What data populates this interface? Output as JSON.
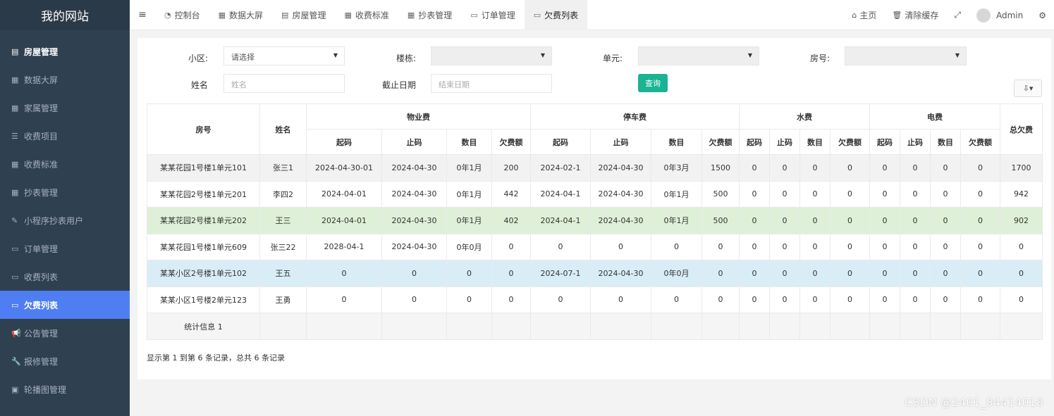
{
  "sidebar": {
    "brand": "我的网站",
    "items": [
      {
        "icon": "document-icon",
        "glyph": "▤",
        "label": "房屋管理"
      },
      {
        "icon": "table-icon",
        "glyph": "▦",
        "label": "数据大屏"
      },
      {
        "icon": "table-icon",
        "glyph": "▦",
        "label": "家属管理"
      },
      {
        "icon": "list-icon",
        "glyph": "☰",
        "label": "收费项目"
      },
      {
        "icon": "table-icon",
        "glyph": "▦",
        "label": "收费标准"
      },
      {
        "icon": "table-icon",
        "glyph": "▦",
        "label": "抄表管理"
      },
      {
        "icon": "edit-icon",
        "glyph": "✎",
        "label": "小程序抄表用户"
      },
      {
        "icon": "card-icon",
        "glyph": "▭",
        "label": "订单管理"
      },
      {
        "icon": "card-icon",
        "glyph": "▭",
        "label": "收费列表"
      },
      {
        "icon": "card-icon",
        "glyph": "▭",
        "label": "欠费列表"
      },
      {
        "icon": "bullhorn-icon",
        "glyph": "📢",
        "label": "公告管理"
      },
      {
        "icon": "wrench-icon",
        "glyph": "🔧",
        "label": "报修管理"
      },
      {
        "icon": "image-icon",
        "glyph": "▣",
        "label": "轮播图管理"
      }
    ],
    "active_color": "#4e7ef1"
  },
  "topbar": {
    "menu_glyph": "≡",
    "tabs": [
      {
        "glyph": "◔",
        "label": "控制台"
      },
      {
        "glyph": "▦",
        "label": "数据大屏"
      },
      {
        "glyph": "▤",
        "label": "房屋管理"
      },
      {
        "glyph": "▦",
        "label": "收费标准"
      },
      {
        "glyph": "▦",
        "label": "抄表管理"
      },
      {
        "glyph": "▭",
        "label": "订单管理"
      },
      {
        "glyph": "▭",
        "label": "欠费列表"
      }
    ],
    "home": {
      "glyph": "⌂",
      "label": "主页"
    },
    "clear_cache": {
      "glyph": "🗑",
      "label": "清除缓存"
    },
    "fullscreen_glyph": "⤢",
    "user": "Admin",
    "settings_glyph": "⚙"
  },
  "filters": {
    "community_label": "小区:",
    "community_value": "请选择",
    "building_label": "楼栋:",
    "building_value": "",
    "unit_label": "单元:",
    "unit_value": "",
    "room_label": "房号:",
    "room_value": "",
    "name_label": "姓名",
    "name_placeholder": "姓名",
    "deadline_label": "截止日期",
    "deadline_placeholder": "结束日期",
    "query_button": "查询",
    "export_glyph": "⇩▾",
    "caret": "▼"
  },
  "table": {
    "group_headers": {
      "room": "房号",
      "name": "姓名",
      "property": "物业费",
      "parking": "停车费",
      "water": "水费",
      "electricity": "电费",
      "total": "总欠费"
    },
    "sub_headers": {
      "property": [
        "起码",
        "止码",
        "数目",
        "欠费额"
      ],
      "parking": [
        "起码",
        "止码",
        "数目",
        "欠费额"
      ],
      "water": [
        "起码",
        "止码",
        "数目",
        "欠费额"
      ],
      "electricity": [
        "起码",
        "止码",
        "数目",
        "欠费额"
      ]
    },
    "rows": [
      [
        "某某花园1号楼1单元101",
        "张三1",
        "2024-04-30-01",
        "2024-04-30",
        "0年1月",
        "200",
        "2024-02-1",
        "2024-04-30",
        "0年3月",
        "1500",
        "0",
        "0",
        "0",
        "0",
        "0",
        "0",
        "0",
        "0",
        "1700"
      ],
      [
        "某某花园2号楼1单元201",
        "李四2",
        "2024-04-01",
        "2024-04-30",
        "0年1月",
        "442",
        "2024-04-1",
        "2024-04-30",
        "0年1月",
        "500",
        "0",
        "0",
        "0",
        "0",
        "0",
        "0",
        "0",
        "0",
        "942"
      ],
      [
        "某某花园2号楼1单元202",
        "王三",
        "2024-04-01",
        "2024-04-30",
        "0年1月",
        "402",
        "2024-04-1",
        "2024-04-30",
        "0年1月",
        "500",
        "0",
        "0",
        "0",
        "0",
        "0",
        "0",
        "0",
        "0",
        "902"
      ],
      [
        "某某花园1号楼1单元609",
        "张三22",
        "2028-04-1",
        "2024-04-30",
        "0年0月",
        "0",
        "0",
        "0",
        "0",
        "0",
        "0",
        "0",
        "0",
        "0",
        "0",
        "0",
        "0",
        "0",
        "0"
      ],
      [
        "某某小区2号楼1单元102",
        "王五",
        "0",
        "0",
        "0",
        "0",
        "2024-07-1",
        "2024-04-30",
        "0年0月",
        "0",
        "0",
        "0",
        "0",
        "0",
        "0",
        "0",
        "0",
        "0",
        "0"
      ],
      [
        "某某小区1号楼2单元123",
        "王勇",
        "0",
        "0",
        "0",
        "0",
        "0",
        "0",
        "0",
        "0",
        "0",
        "0",
        "0",
        "0",
        "0",
        "0",
        "0",
        "0",
        "0"
      ]
    ],
    "row_styles": [
      "r-gray",
      "r-white",
      "r-green",
      "r-white",
      "r-blue",
      "r-white"
    ],
    "row_colors": {
      "highlight_green": "#dff0d8",
      "highlight_blue": "#d9edf7"
    },
    "footer": "统计信息 1"
  },
  "pagination_text": "显示第 1 到第 6 条记录，总共 6 条记录",
  "watermark": "CSDN @2401_84414018"
}
